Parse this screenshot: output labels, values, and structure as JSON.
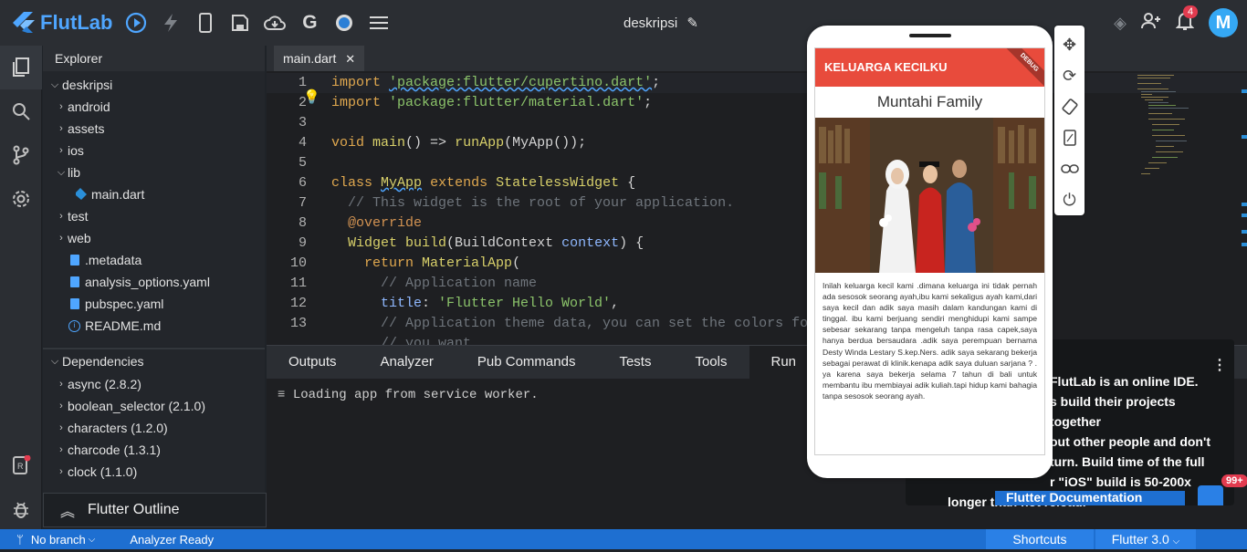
{
  "app": {
    "name": "FlutLab",
    "project_title": "deskripsi",
    "avatar_letter": "M",
    "notif_count": "4",
    "badge_99": "99+"
  },
  "colors": {
    "brand": "#4fa6ff",
    "statusbar": "#1e6fd1",
    "appbar_red": "#e84b3c"
  },
  "explorer": {
    "title": "Explorer",
    "root": "deskripsi",
    "items": [
      {
        "label": "android",
        "type": "folder"
      },
      {
        "label": "assets",
        "type": "folder"
      },
      {
        "label": "ios",
        "type": "folder"
      },
      {
        "label": "lib",
        "type": "folder-open"
      },
      {
        "label": "main.dart",
        "type": "dart"
      },
      {
        "label": "test",
        "type": "folder"
      },
      {
        "label": "web",
        "type": "folder"
      },
      {
        "label": ".metadata",
        "type": "file"
      },
      {
        "label": "analysis_options.yaml",
        "type": "file"
      },
      {
        "label": "pubspec.yaml",
        "type": "file"
      },
      {
        "label": "README.md",
        "type": "info"
      }
    ]
  },
  "dependencies": {
    "title": "Dependencies",
    "items": [
      "async (2.8.2)",
      "boolean_selector (2.1.0)",
      "characters (1.2.0)",
      "charcode (1.3.1)",
      "clock (1.1.0)"
    ]
  },
  "outline": {
    "label": "Flutter Outline"
  },
  "editor": {
    "tab": "main.dart",
    "line_numbers": [
      "1",
      "2",
      "3",
      "4",
      "5",
      "6",
      "7",
      "8",
      "9",
      "10",
      "11",
      "12",
      "13"
    ]
  },
  "code": {
    "l1_kw": "import",
    "l1_str": "'package:flutter/cupertino.dart'",
    "l2_kw": "import",
    "l2_str": "'package:flutter/material.dart'",
    "l4_a": "void",
    "l4_b": "main",
    "l4_c": "() => ",
    "l4_d": "runApp",
    "l4_e": "(MyApp());",
    "l6_a": "class",
    "l6_b": "MyApp",
    "l6_c": "extends",
    "l6_d": "StatelessWidget",
    "l6_e": " {",
    "l7": "// This widget is the root of your application.",
    "l8": "@override",
    "l9_a": "Widget",
    "l9_b": "build",
    "l9_c": "(BuildContext ",
    "l9_d": "context",
    "l9_e": ") {",
    "l10_a": "return",
    "l10_b": "MaterialApp",
    "l10_c": "(",
    "l11": "// Application name",
    "l12_a": "title",
    "l12_b": ": ",
    "l12_c": "'Flutter Hello World'",
    "l12_d": ",",
    "l13": "// Application theme data, you can set the colors for",
    "l14": "// you want"
  },
  "panel": {
    "tabs": [
      "Outputs",
      "Analyzer",
      "Pub Commands",
      "Tests",
      "Tools",
      "Run"
    ],
    "active": "Run",
    "log": "Loading app from service worker."
  },
  "tooltip": {
    "lines": [
      "FlutLab is an online IDE.",
      "s build their projects together",
      "out other people and don't",
      "turn. Build time of the full",
      "r \"iOS\" build is 50-200x",
      "longer than hot reload."
    ],
    "button": "Flutter Documentation"
  },
  "phone": {
    "appbar_title": "KELUARGA KECILKU",
    "debug": "DEBUG",
    "family_name": "Muntahi Family",
    "paragraph": "Inilah keluarga kecil kami .dimana keluarga ini tidak pernah ada sesosok seorang ayah,ibu kami sekaligus ayah kami,dari saya kecil dan adik saya masih dalam kandungan kami di tinggal. ibu kami berjuang sendiri menghidupi kami sampe sebesar sekarang tanpa mengeluh tanpa rasa  capek,saya hanya berdua bersaudara .adik saya perempuan bernama Desty Winda Lestary S.kep.Ners. adik saya sekarang bekerja sebagai perawat di klinik.kenapa adik saya duluan sarjana ? . ya karena saya bekerja selama 7 tahun di bali untuk membantu ibu membiayai adik kuliah.tapi hidup kami bahagia tanpa sesosok seorang ayah."
  },
  "statusbar": {
    "branch": "No branch",
    "analyzer": "Analyzer Ready",
    "shortcuts": "Shortcuts",
    "flutter_version": "Flutter 3.0"
  }
}
